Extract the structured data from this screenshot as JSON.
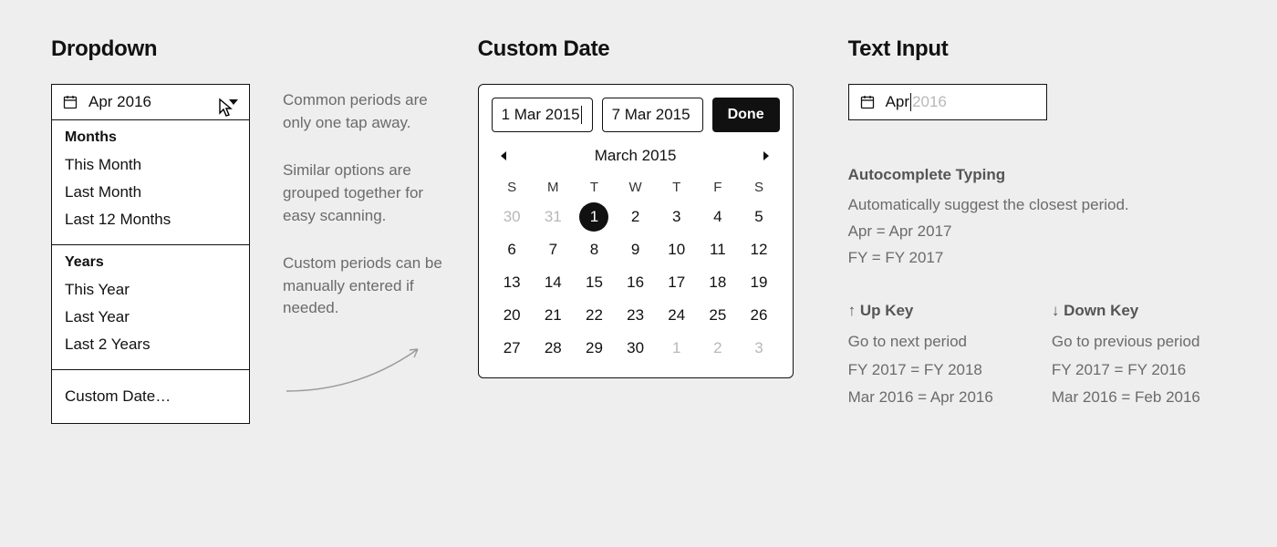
{
  "dropdown": {
    "title": "Dropdown",
    "value": "Apr 2016",
    "groups": [
      {
        "header": "Months",
        "items": [
          "This Month",
          "Last Month",
          "Last 12 Months"
        ]
      },
      {
        "header": "Years",
        "items": [
          "This Year",
          "Last Year",
          "Last 2 Years"
        ]
      }
    ],
    "custom": "Custom Date…",
    "notes": [
      "Common periods are only one tap away.",
      "Similar options are grouped together for easy scanning.",
      "Custom periods can be manually entered if needed."
    ]
  },
  "customDate": {
    "title": "Custom Date",
    "from": "1 Mar 2015",
    "to": "7 Mar 2015",
    "done": "Done",
    "monthLabel": "March 2015",
    "dow": [
      "S",
      "M",
      "T",
      "W",
      "T",
      "F",
      "S"
    ],
    "prevTrail": [
      30,
      31
    ],
    "days": [
      1,
      2,
      3,
      4,
      5,
      6,
      7,
      8,
      9,
      10,
      11,
      12,
      13,
      14,
      15,
      16,
      17,
      18,
      19,
      20,
      21,
      22,
      23,
      24,
      25,
      26,
      27,
      28,
      29,
      30
    ],
    "nextTrail": [
      1,
      2,
      3
    ],
    "selected": 1
  },
  "textInput": {
    "title": "Text Input",
    "typed": "Apr",
    "suggest": "2016",
    "autocomplete": {
      "head": "Autocomplete Typing",
      "desc": "Automatically suggest the closest period.",
      "ex1": "Apr  =  Apr 2017",
      "ex2": "FY  =  FY 2017"
    },
    "up": {
      "head": "↑ Up Key",
      "desc": "Go to next period",
      "ex1": "FY 2017  =  FY 2018",
      "ex2": "Mar 2016  =  Apr 2016"
    },
    "down": {
      "head": "↓ Down Key",
      "desc": "Go to previous period",
      "ex1": "FY 2017  =  FY 2016",
      "ex2": "Mar 2016  =  Feb 2016"
    }
  }
}
